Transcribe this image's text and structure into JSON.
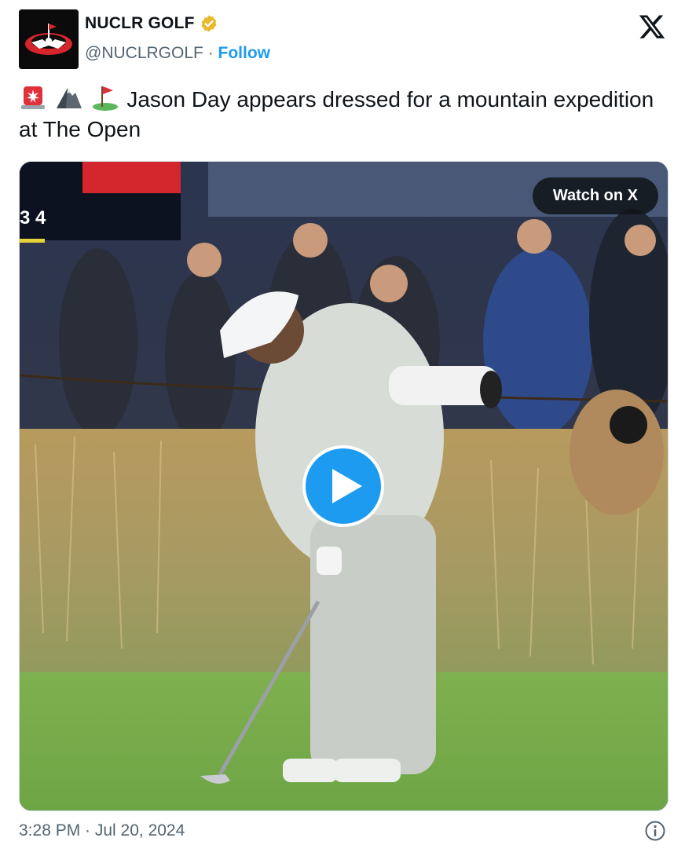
{
  "author": {
    "name": "NUCLR GOLF",
    "handle": "@NUCLRGOLF",
    "separator": "·",
    "follow_label": "Follow",
    "verified_color": "#e8b92a"
  },
  "tweet": {
    "emojis": [
      "police-light-emoji",
      "mountain-emoji",
      "golf-flag-emoji"
    ],
    "text": "Jason Day appears dressed for a mountain expedition at The Open"
  },
  "media": {
    "watch_label": "Watch on X",
    "scoreboard_text": "3 4"
  },
  "footer": {
    "timestamp": "3:28 PM · Jul 20, 2024"
  },
  "colors": {
    "accent": "#1d9bf0",
    "text": "#0f1419",
    "secondary": "#536471"
  }
}
